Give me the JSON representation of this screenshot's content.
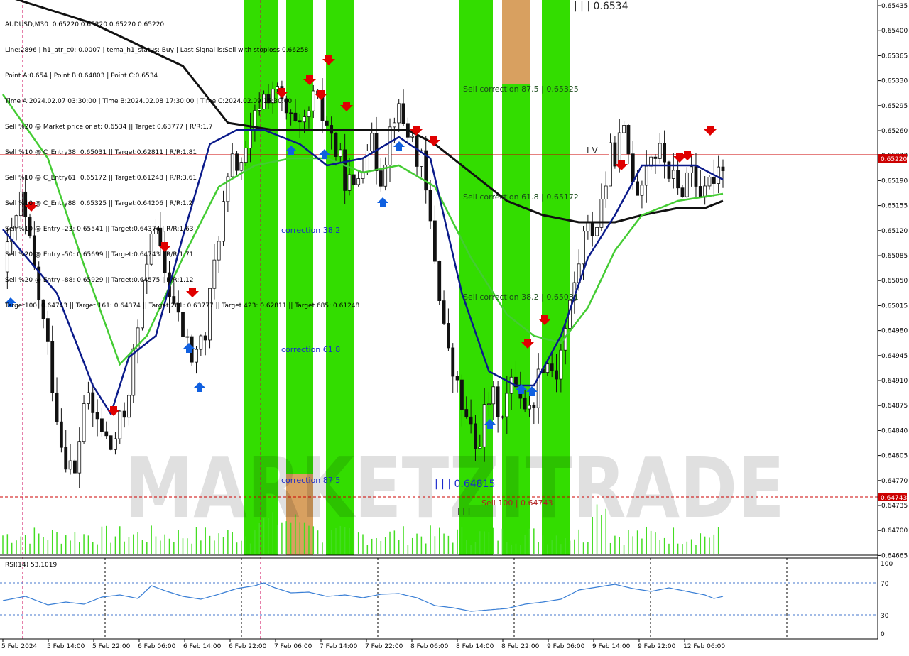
{
  "header": {
    "symbol": "AUDUSD,M30  0.65220 0.65220 0.65220 0.65220",
    "info_lines": [
      "Line:2896 | h1_atr_c0: 0.0007 | tema_h1_status: Buy | Last Signal is:Sell with stoploss:0.66258",
      "Point A:0.654 | Point B:0.64803 | Point C:0.6534",
      "Time A:2024.02.07 03:30:00 | Time B:2024.02.08 17:30:00 | Time C:2024.02.09 15:30:00",
      "Sell %20 @ Market price or at: 0.6534 || Target:0.63777 | R/R:1.7",
      "Sell %10 @ C_Entry38: 0.65031 || Target:0.62811 | R/R:1.81",
      "Sell %10 @ C_Entry61: 0.65172 || Target:0.61248 | R/R:3.61",
      "Sell %10 @ C_Entry88: 0.65325 || Target:0.64206 | R/R:1.2",
      "Sell %10 @ Entry -23: 0.65541 || Target:0.64374 | R/R:1.63",
      "Sell %20 @ Entry -50: 0.65699 || Target:0.64743 | R/R:1.71",
      "Sell %20 @ Entry -88: 0.65929 || Target:0.64575 | R/R:1.12",
      "Target100: 0.64743 || Target 161: 0.64374 || Target 261: 0.63777 || Target 423: 0.62811 || Target 685: 0.61248"
    ]
  },
  "watermark": "MARKETZITRADE",
  "price_axis": {
    "ticks": [
      "0.65435",
      "0.65400",
      "0.65365",
      "0.65330",
      "0.65295",
      "0.65260",
      "0.65220",
      "0.65190",
      "0.65155",
      "0.65120",
      "0.65085",
      "0.65050",
      "0.65015",
      "0.64980",
      "0.64945",
      "0.64910",
      "0.64875",
      "0.64840",
      "0.64805",
      "0.64770",
      "0.64735",
      "0.64700",
      "0.64665"
    ],
    "current_price_label": "0.65220",
    "target_label": "0.64743"
  },
  "annotations": {
    "point_c": "| | | 0.6534",
    "point_b": "| | | 0.64815",
    "wave_iv": "I V",
    "wave_iii": "I I I",
    "sell_correction_875": "Sell correction 87.5 | 0.65325",
    "sell_correction_618": "Sell correction 61.8 | 0.65172",
    "sell_correction_382": "Sell correction 38.2 | 0.65031",
    "sell_100": "Sell 100 | 0.64743",
    "correction_382": "correction 38.2",
    "correction_618": "correction 61.8",
    "correction_875": "correction 87.5"
  },
  "rsi": {
    "label": "RSI(14) 53.1019",
    "levels": [
      "100",
      "70",
      "30",
      "0"
    ]
  },
  "time_axis": [
    "5 Feb 2024",
    "5 Feb 14:00",
    "5 Feb 22:00",
    "6 Feb 06:00",
    "6 Feb 14:00",
    "6 Feb 22:00",
    "7 Feb 06:00",
    "7 Feb 14:00",
    "7 Feb 22:00",
    "8 Feb 06:00",
    "8 Feb 14:00",
    "8 Feb 22:00",
    "9 Feb 06:00",
    "9 Feb 14:00",
    "9 Feb 22:00",
    "12 Feb 06:00"
  ],
  "colors": {
    "zone_green": "#33dd00",
    "zone_orange": "#d8a060",
    "ema_blue": "#0a1a8a",
    "ema_green": "#44cc33",
    "ema_black": "#111111",
    "sell_arrow": "#e00000",
    "buy_arrow": "#1060e0",
    "price_line": "#cc0000",
    "rsi_line": "#3a7fd5",
    "volume": "#44dd22"
  },
  "chart_data": {
    "type": "candlestick",
    "symbol": "AUDUSD",
    "timeframe": "M30",
    "current_price": 0.6522,
    "ylim": [
      0.64665,
      0.65435
    ],
    "levels": {
      "point_a": 0.654,
      "point_b": 0.64803,
      "point_c": 0.6534,
      "target_100": 0.64743,
      "c_entry38": 0.65031,
      "c_entry61": 0.65172,
      "c_entry88": 0.65325
    },
    "close_path": [
      [
        0,
        0.6506
      ],
      [
        4,
        0.6516
      ],
      [
        7,
        0.6506
      ],
      [
        10,
        0.6495
      ],
      [
        13,
        0.6482
      ],
      [
        16,
        0.6477
      ],
      [
        18,
        0.6488
      ],
      [
        21,
        0.6485
      ],
      [
        24,
        0.6481
      ],
      [
        27,
        0.6486
      ],
      [
        30,
        0.6498
      ],
      [
        33,
        0.6513
      ],
      [
        36,
        0.6506
      ],
      [
        39,
        0.6499
      ],
      [
        42,
        0.6494
      ],
      [
        45,
        0.6497
      ],
      [
        48,
        0.6512
      ],
      [
        51,
        0.6521
      ],
      [
        54,
        0.6522
      ],
      [
        57,
        0.653
      ],
      [
        60,
        0.6532
      ],
      [
        63,
        0.6528
      ],
      [
        66,
        0.6525
      ],
      [
        69,
        0.653
      ],
      [
        72,
        0.6527
      ],
      [
        75,
        0.6521
      ],
      [
        78,
        0.6517
      ],
      [
        81,
        0.6525
      ],
      [
        84,
        0.652
      ],
      [
        87,
        0.6529
      ],
      [
        90,
        0.6526
      ],
      [
        93,
        0.6521
      ],
      [
        96,
        0.6508
      ],
      [
        99,
        0.6494
      ],
      [
        102,
        0.6487
      ],
      [
        105,
        0.6481
      ],
      [
        108,
        0.6488
      ],
      [
        111,
        0.6487
      ],
      [
        114,
        0.6491
      ],
      [
        117,
        0.6486
      ],
      [
        120,
        0.6494
      ],
      [
        123,
        0.6492
      ],
      [
        126,
        0.6501
      ],
      [
        129,
        0.6511
      ],
      [
        132,
        0.6513
      ],
      [
        135,
        0.6522
      ],
      [
        138,
        0.6525
      ],
      [
        141,
        0.6518
      ],
      [
        144,
        0.6523
      ],
      [
        147,
        0.6522
      ],
      [
        150,
        0.6517
      ],
      [
        153,
        0.6521
      ],
      [
        156,
        0.6516
      ],
      [
        158,
        0.652
      ],
      [
        160,
        0.6522
      ]
    ],
    "ema_blue": [
      [
        0,
        0.6512
      ],
      [
        12,
        0.6503
      ],
      [
        20,
        0.649
      ],
      [
        24,
        0.6486
      ],
      [
        28,
        0.6494
      ],
      [
        34,
        0.6497
      ],
      [
        40,
        0.6511
      ],
      [
        46,
        0.6524
      ],
      [
        52,
        0.6526
      ],
      [
        58,
        0.6526
      ],
      [
        66,
        0.6524
      ],
      [
        72,
        0.6521
      ],
      [
        80,
        0.6522
      ],
      [
        88,
        0.6525
      ],
      [
        95,
        0.6522
      ],
      [
        102,
        0.6503
      ],
      [
        108,
        0.6492
      ],
      [
        114,
        0.649
      ],
      [
        118,
        0.649
      ],
      [
        124,
        0.6497
      ],
      [
        130,
        0.6508
      ],
      [
        136,
        0.6514
      ],
      [
        142,
        0.6521
      ],
      [
        148,
        0.6521
      ],
      [
        154,
        0.6521
      ],
      [
        160,
        0.6519
      ]
    ],
    "ema_green": [
      [
        0,
        0.6531
      ],
      [
        10,
        0.6522
      ],
      [
        18,
        0.6507
      ],
      [
        26,
        0.6493
      ],
      [
        32,
        0.6497
      ],
      [
        40,
        0.6508
      ],
      [
        48,
        0.6518
      ],
      [
        56,
        0.6521
      ],
      [
        64,
        0.6522
      ],
      [
        72,
        0.6522
      ],
      [
        80,
        0.652
      ],
      [
        88,
        0.6521
      ],
      [
        96,
        0.6518
      ],
      [
        104,
        0.6508
      ],
      [
        112,
        0.65
      ],
      [
        118,
        0.6497
      ],
      [
        124,
        0.6496
      ],
      [
        130,
        0.6501
      ],
      [
        136,
        0.6509
      ],
      [
        142,
        0.6514
      ],
      [
        150,
        0.6516
      ],
      [
        160,
        0.6517
      ]
    ],
    "ema_black": [
      [
        0,
        0.6545
      ],
      [
        20,
        0.6541
      ],
      [
        40,
        0.6535
      ],
      [
        50,
        0.6527
      ],
      [
        60,
        0.6526
      ],
      [
        70,
        0.6526
      ],
      [
        80,
        0.6526
      ],
      [
        90,
        0.6526
      ],
      [
        96,
        0.6524
      ],
      [
        104,
        0.652
      ],
      [
        112,
        0.6516
      ],
      [
        120,
        0.6514
      ],
      [
        128,
        0.6513
      ],
      [
        136,
        0.6513
      ],
      [
        142,
        0.6514
      ],
      [
        150,
        0.6515
      ],
      [
        156,
        0.6515
      ],
      [
        160,
        0.6516
      ]
    ],
    "rsi": [
      [
        0,
        47
      ],
      [
        5,
        53
      ],
      [
        10,
        41
      ],
      [
        14,
        45
      ],
      [
        18,
        42
      ],
      [
        22,
        52
      ],
      [
        26,
        55
      ],
      [
        30,
        50
      ],
      [
        33,
        68
      ],
      [
        36,
        61
      ],
      [
        40,
        53
      ],
      [
        44,
        49
      ],
      [
        48,
        56
      ],
      [
        52,
        64
      ],
      [
        56,
        68
      ],
      [
        58,
        72
      ],
      [
        60,
        66
      ],
      [
        64,
        58
      ],
      [
        68,
        59
      ],
      [
        72,
        53
      ],
      [
        76,
        55
      ],
      [
        80,
        51
      ],
      [
        84,
        56
      ],
      [
        88,
        57
      ],
      [
        92,
        51
      ],
      [
        96,
        40
      ],
      [
        100,
        37
      ],
      [
        104,
        32
      ],
      [
        108,
        34
      ],
      [
        112,
        36
      ],
      [
        116,
        42
      ],
      [
        120,
        45
      ],
      [
        124,
        49
      ],
      [
        128,
        62
      ],
      [
        132,
        66
      ],
      [
        136,
        70
      ],
      [
        140,
        64
      ],
      [
        144,
        60
      ],
      [
        148,
        65
      ],
      [
        152,
        60
      ],
      [
        156,
        55
      ],
      [
        158,
        50
      ],
      [
        160,
        53
      ]
    ],
    "rsi_levels": [
      30,
      70
    ]
  }
}
